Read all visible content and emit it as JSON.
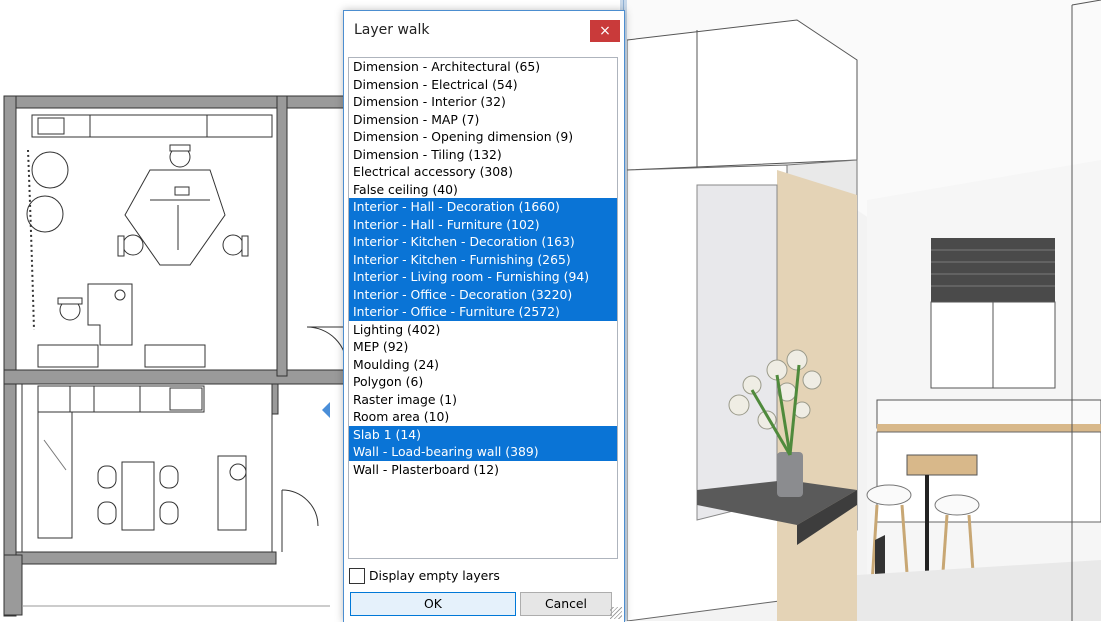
{
  "dialog": {
    "title": "Layer walk",
    "close_icon": "close-icon",
    "close_glyph": "×",
    "layers": [
      {
        "label": "Dimension - Architectural (65)",
        "selected": false
      },
      {
        "label": "Dimension - Electrical (54)",
        "selected": false
      },
      {
        "label": "Dimension - Interior (32)",
        "selected": false
      },
      {
        "label": "Dimension - MAP (7)",
        "selected": false
      },
      {
        "label": "Dimension - Opening dimension (9)",
        "selected": false
      },
      {
        "label": "Dimension - Tiling (132)",
        "selected": false
      },
      {
        "label": "Electrical accessory (308)",
        "selected": false
      },
      {
        "label": "False ceiling (40)",
        "selected": false
      },
      {
        "label": "Interior - Hall - Decoration (1660)",
        "selected": true
      },
      {
        "label": "Interior - Hall - Furniture (102)",
        "selected": true
      },
      {
        "label": "Interior - Kitchen - Decoration (163)",
        "selected": true
      },
      {
        "label": "Interior - Kitchen - Furnishing (265)",
        "selected": true
      },
      {
        "label": "Interior - Living room - Furnishing (94)",
        "selected": true
      },
      {
        "label": "Interior - Office - Decoration (3220)",
        "selected": true
      },
      {
        "label": "Interior - Office - Furniture (2572)",
        "selected": true
      },
      {
        "label": "Lighting (402)",
        "selected": false
      },
      {
        "label": "MEP (92)",
        "selected": false
      },
      {
        "label": "Moulding (24)",
        "selected": false
      },
      {
        "label": "Polygon (6)",
        "selected": false
      },
      {
        "label": "Raster image (1)",
        "selected": false
      },
      {
        "label": "Room area (10)",
        "selected": false
      },
      {
        "label": "Slab 1 (14)",
        "selected": true
      },
      {
        "label": "Wall - Load-bearing wall (389)",
        "selected": true
      },
      {
        "label": "Wall - Plasterboard (12)",
        "selected": false
      }
    ],
    "display_empty_label": "Display empty layers",
    "display_empty_checked": false,
    "ok_label": "OK",
    "cancel_label": "Cancel"
  },
  "colors": {
    "selection": "#0a74d6",
    "close_button": "#c93a3a",
    "dialog_border": "#4c8ed0"
  }
}
